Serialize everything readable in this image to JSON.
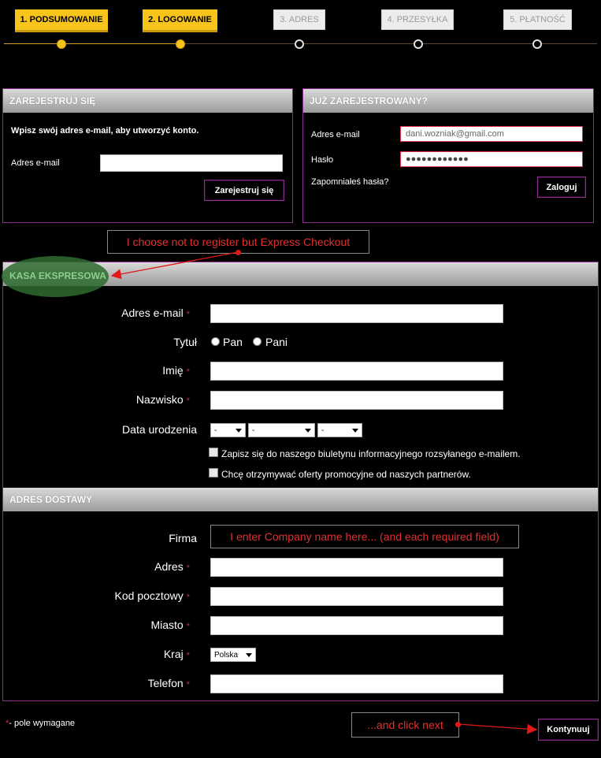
{
  "steps": [
    {
      "label": "1. PODSUMOWANIE",
      "state": "done"
    },
    {
      "label": "2. LOGOWANIE",
      "state": "done"
    },
    {
      "label": "3. ADRES",
      "state": "todo"
    },
    {
      "label": "4. PRZESYŁKA",
      "state": "todo"
    },
    {
      "label": "5. PŁATNOŚĆ",
      "state": "todo"
    }
  ],
  "register": {
    "title": "ZAREJESTRUJ SIĘ",
    "intro": "Wpisz swój adres e-mail, aby utworzyć konto.",
    "email_label": "Adres e-mail",
    "email_value": "",
    "button": "Zarejestruj się"
  },
  "login": {
    "title": "JUŻ ZAREJESTROWANY?",
    "email_label": "Adres e-mail",
    "email_value": "dani.wozniak@gmail.com",
    "password_label": "Hasło",
    "password_value": "●●●●●●●●●●●●",
    "forgot": "Zapomniałeś hasła?",
    "button": "Zaloguj"
  },
  "express": {
    "title": "KASA EKSPRESOWA",
    "email_label": "Adres e-mail",
    "title_label": "Tytuł",
    "title_options": [
      "Pan",
      "Pani"
    ],
    "first_name_label": "Imię",
    "last_name_label": "Nazwisko",
    "birthdate_label": "Data urodzenia",
    "birth_day": "-",
    "birth_month": "-",
    "birth_year": "-",
    "newsletter_label": "Zapisz się do naszego biuletynu informacyjnego rozsyłanego e-mailem.",
    "partners_label": "Chcę otrzymywać oferty promocyjne od naszych partnerów.",
    "required_mark": "*"
  },
  "delivery": {
    "title": "ADRES DOSTAWY",
    "company_label": "Firma",
    "address_label": "Adres",
    "postcode_label": "Kod pocztowy",
    "city_label": "Miasto",
    "country_label": "Kraj",
    "country_value": "Polska",
    "phone_label": "Telefon"
  },
  "footer": {
    "required_note": "- pole wymagane",
    "continue_button": "Kontynuuj"
  },
  "annotations": {
    "express_note": "I choose not to register but Express Checkout",
    "company_note": "I enter Company name here... (and each required field)",
    "next_note": "...and click next"
  },
  "colors": {
    "active_step": "#f6c41b",
    "panel_border": "#8a2d8e",
    "annotation_text": "#e23030",
    "highlight_ellipse": "#2e6b2e"
  }
}
